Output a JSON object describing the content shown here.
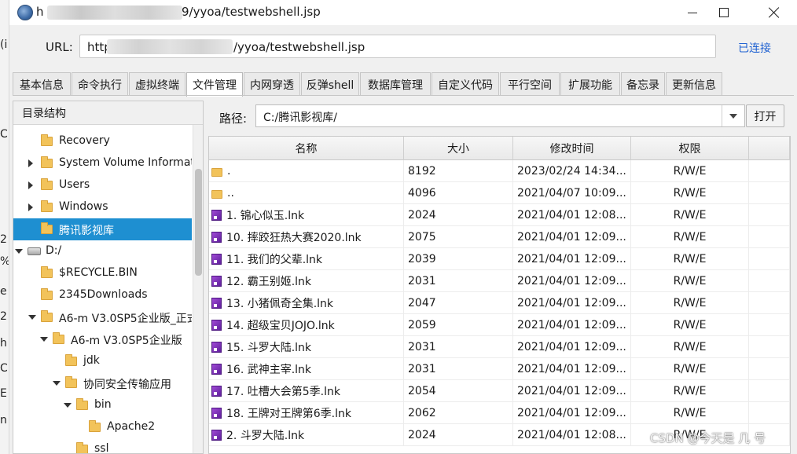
{
  "background_window": {
    "fragments": [
      "(i",
      "C",
      "2",
      "%",
      "e",
      "2",
      "h",
      "C",
      "E",
      "n"
    ]
  },
  "titlebar": {
    "title_prefix": "h",
    "title": "9/yyoa/testwebshell.jsp",
    "icons": [
      "app-icon",
      "minimize-icon",
      "maximize-icon",
      "close-icon"
    ]
  },
  "connection": {
    "url_label": "URL:",
    "url_prefix": "http",
    "url_tail": "/yyoa/testwebshell.jsp",
    "status": "已连接",
    "status_color": "#1c5fd1"
  },
  "tabs": [
    {
      "label": "基本信息",
      "active": false
    },
    {
      "label": "命令执行",
      "active": false
    },
    {
      "label": "虚拟终端",
      "active": false
    },
    {
      "label": "文件管理",
      "active": true
    },
    {
      "label": "内网穿透",
      "active": false
    },
    {
      "label": "反弹shell",
      "active": false
    },
    {
      "label": "数据库管理",
      "active": false
    },
    {
      "label": "自定义代码",
      "active": false
    },
    {
      "label": "平行空间",
      "active": false
    },
    {
      "label": "扩展功能",
      "active": false
    },
    {
      "label": "备忘录",
      "active": false
    },
    {
      "label": "更新信息",
      "active": false
    }
  ],
  "tree": {
    "header": "目录结构",
    "rows": [
      {
        "label": "Recovery",
        "depth": 2,
        "toggle": "none",
        "icon": "folder-icon",
        "selected": false
      },
      {
        "label": "System Volume Information",
        "depth": 2,
        "toggle": "collapsed",
        "icon": "folder-icon",
        "selected": false
      },
      {
        "label": "Users",
        "depth": 2,
        "toggle": "collapsed",
        "icon": "folder-icon",
        "selected": false
      },
      {
        "label": "Windows",
        "depth": 2,
        "toggle": "collapsed",
        "icon": "folder-icon",
        "selected": false
      },
      {
        "label": "腾讯影视库",
        "depth": 2,
        "toggle": "none",
        "icon": "folder-icon",
        "selected": true
      },
      {
        "label": "D:/",
        "depth": 1,
        "toggle": "expanded",
        "icon": "drive-icon",
        "selected": false
      },
      {
        "label": "$RECYCLE.BIN",
        "depth": 2,
        "toggle": "none",
        "icon": "folder-icon",
        "selected": false
      },
      {
        "label": "2345Downloads",
        "depth": 2,
        "toggle": "none",
        "icon": "folder-icon",
        "selected": false
      },
      {
        "label": "A6-m V3.0SP5企业版_正式版",
        "depth": 2,
        "toggle": "expanded",
        "icon": "folder-icon",
        "selected": false
      },
      {
        "label": "A6-m V3.0SP5企业版",
        "depth": 3,
        "toggle": "expanded",
        "icon": "folder-icon",
        "selected": false
      },
      {
        "label": "jdk",
        "depth": 4,
        "toggle": "none",
        "icon": "folder-icon",
        "selected": false
      },
      {
        "label": "协同安全传输应用",
        "depth": 4,
        "toggle": "expanded",
        "icon": "folder-icon",
        "selected": false
      },
      {
        "label": "bin",
        "depth": 5,
        "toggle": "expanded",
        "icon": "folder-icon",
        "selected": false
      },
      {
        "label": "Apache2",
        "depth": 6,
        "toggle": "none",
        "icon": "folder-icon",
        "selected": false
      },
      {
        "label": "ssl",
        "depth": 5,
        "toggle": "none",
        "icon": "folder-icon",
        "selected": false
      }
    ]
  },
  "path": {
    "label": "路径:",
    "value": "C:/腾讯影视库/",
    "open_button": "打开"
  },
  "table": {
    "columns": [
      "名称",
      "大小",
      "修改时间",
      "权限"
    ],
    "rows": [
      {
        "name": ".",
        "size": "8192",
        "time": "2023/02/24 14:34...",
        "perm": "R/W/E",
        "icon": "folder-icon"
      },
      {
        "name": "..",
        "size": "4096",
        "time": "2021/04/07 10:09...",
        "perm": "R/W/E",
        "icon": "folder-icon"
      },
      {
        "name": "1. 锦心似玉.lnk",
        "size": "2024",
        "time": "2021/04/01 12:08...",
        "perm": "R/W/E",
        "icon": "shortcut-icon"
      },
      {
        "name": "10. 摔跤狂热大赛2020.lnk",
        "size": "2075",
        "time": "2021/04/01 12:09...",
        "perm": "R/W/E",
        "icon": "shortcut-icon"
      },
      {
        "name": "11. 我们的父辈.lnk",
        "size": "2039",
        "time": "2021/04/01 12:09...",
        "perm": "R/W/E",
        "icon": "shortcut-icon"
      },
      {
        "name": "12. 霸王别姬.lnk",
        "size": "2031",
        "time": "2021/04/01 12:09...",
        "perm": "R/W/E",
        "icon": "shortcut-icon"
      },
      {
        "name": "13. 小猪佩奇全集.lnk",
        "size": "2047",
        "time": "2021/04/01 12:09...",
        "perm": "R/W/E",
        "icon": "shortcut-icon"
      },
      {
        "name": "14. 超级宝贝JOJO.lnk",
        "size": "2059",
        "time": "2021/04/01 12:09...",
        "perm": "R/W/E",
        "icon": "shortcut-icon"
      },
      {
        "name": "15. 斗罗大陆.lnk",
        "size": "2031",
        "time": "2021/04/01 12:09...",
        "perm": "R/W/E",
        "icon": "shortcut-icon"
      },
      {
        "name": "16. 武神主宰.lnk",
        "size": "2031",
        "time": "2021/04/01 12:09...",
        "perm": "R/W/E",
        "icon": "shortcut-icon"
      },
      {
        "name": "17. 吐槽大会第5季.lnk",
        "size": "2054",
        "time": "2021/04/01 12:09...",
        "perm": "R/W/E",
        "icon": "shortcut-icon"
      },
      {
        "name": "18. 王牌对王牌第6季.lnk",
        "size": "2062",
        "time": "2021/04/01 12:09...",
        "perm": "R/W/E",
        "icon": "shortcut-icon"
      },
      {
        "name": "2. 斗罗大陆.lnk",
        "size": "2024",
        "time": "2021/04/01 12:08...",
        "perm": "R/W/E",
        "icon": "shortcut-icon"
      }
    ]
  },
  "watermark": "CSDN @今天是 几 号"
}
